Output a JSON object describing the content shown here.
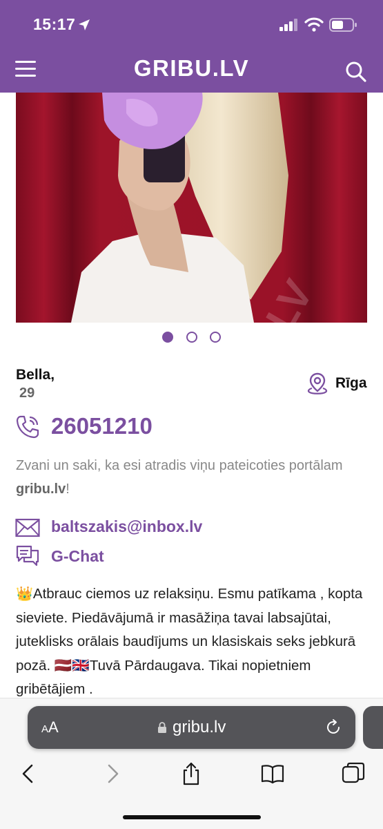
{
  "status_bar": {
    "time": "15:17"
  },
  "header": {
    "logo": "GRIBU.LV"
  },
  "gallery": {
    "active_index": 0,
    "count": 3
  },
  "profile": {
    "name": "Bella,",
    "age": "29",
    "city": "Rīga",
    "phone": "26051210",
    "hint_prefix": "Zvani un saki, ka esi atradis viņu pateicoties portālam ",
    "hint_site": "gribu.lv",
    "hint_suffix": "!",
    "email": "baltszakis@inbox.lv",
    "chat_label": "G-Chat",
    "description_emoji": "👑",
    "description": "Atbrauc ciemos uz relaksiņu. Esmu patīkama , kopta sieviete. Piedāvājumā ir masāžiņa tavai labsajūtai, juteklisks orālais baudījums un klasiskais seks jebkurā pozā. 🇱🇻🇬🇧Tuvā Pārdaugava. Tikai nopietniem gribētājiem ."
  },
  "browser": {
    "text_size_label_small": "A",
    "text_size_label_large": "A",
    "url": "gribu.lv"
  },
  "colors": {
    "brand": "#7b4fa0",
    "pill": "#545458"
  }
}
